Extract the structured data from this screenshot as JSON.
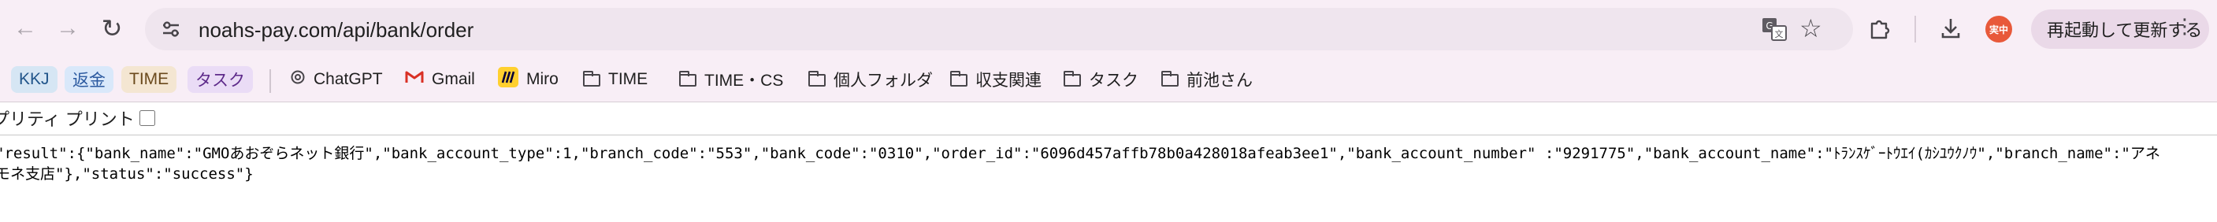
{
  "toolbar": {
    "url": "noahs-pay.com/api/bank/order",
    "update_button_label": "再起動して更新する",
    "update_button_dots": "⋮",
    "avatar_text": "実中"
  },
  "bookmarks": [
    {
      "label": "KKJ",
      "type": "chip"
    },
    {
      "label": "返金",
      "type": "chip"
    },
    {
      "label": "TIME",
      "type": "chip"
    },
    {
      "label": "タスク",
      "type": "chip"
    },
    {
      "label": "ChatGPT",
      "icon": "chatgpt-icon"
    },
    {
      "label": "Gmail",
      "icon": "gmail-icon"
    },
    {
      "label": "Miro",
      "icon": "miro-icon"
    },
    {
      "label": "TIME",
      "icon": "folder-icon"
    },
    {
      "label": "TIME・CS",
      "icon": "folder-icon"
    },
    {
      "label": "個人フォルダ",
      "icon": "folder-icon"
    },
    {
      "label": "収支関連",
      "icon": "folder-icon"
    },
    {
      "label": "タスク",
      "icon": "folder-icon"
    },
    {
      "label": "前池さん",
      "icon": "folder-icon"
    }
  ],
  "viewer": {
    "pretty_print_label": "プリティ プリント",
    "body_text": "\"result\":{\"bank_name\":\"GMOあおぞらネット銀行\",\"bank_account_type\":1,\"branch_code\":\"553\",\"bank_code\":\"0310\",\"order_id\":\"6096d457affb78b0a428018afeab3ee1\",\"bank_account_number\" :\"9291775\",\"bank_account_name\":\"ﾄﾗﾝｽｹﾞｰﾄｳｴｲ(ｶｼﾕｳｸﾉｳ\",\"branch_name\":\"アネモネ支店\"},\"status\":\"success\"}"
  },
  "colors": {
    "toolbar_bg": "#f8eef6",
    "omnibox_bg": "#efe5ee",
    "avatar_bg": "#e8593a"
  }
}
